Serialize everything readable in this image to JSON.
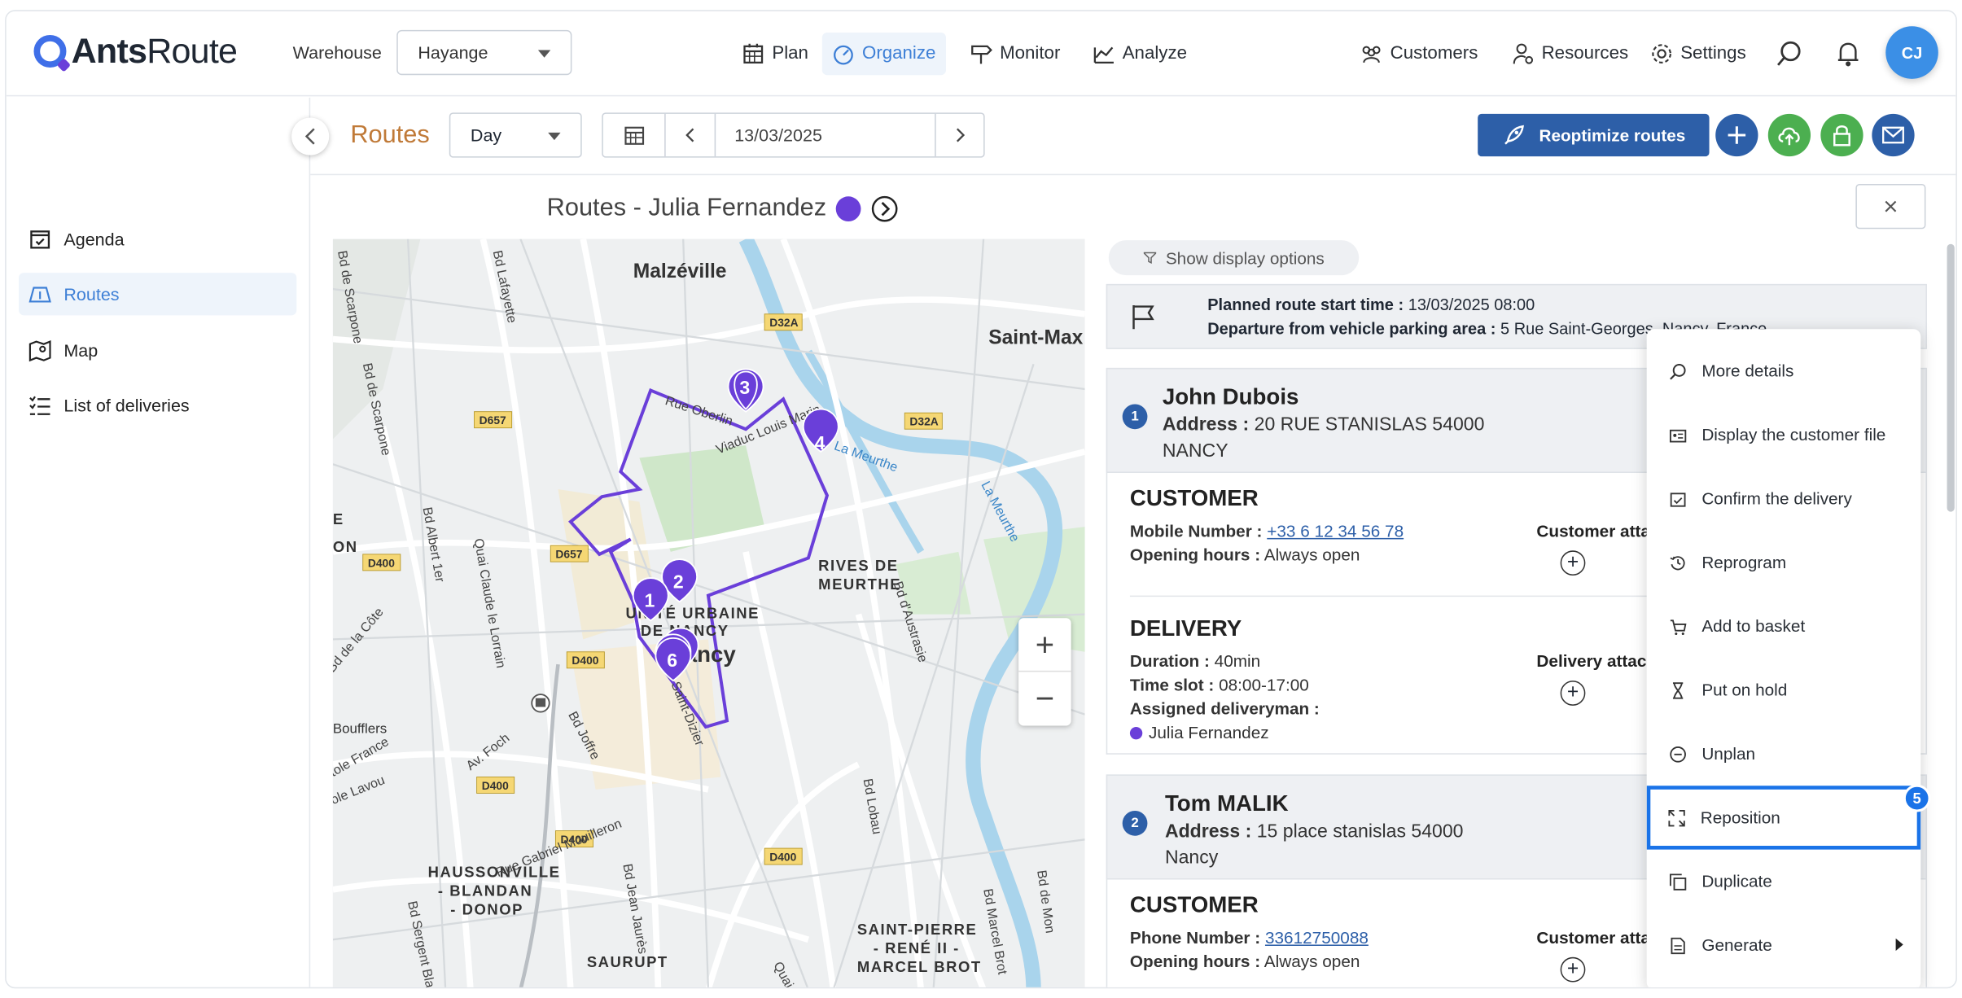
{
  "app": {
    "logo_brand": "Ants",
    "logo_suffix": "Route"
  },
  "header": {
    "warehouse_label": "Warehouse",
    "warehouse_value": "Hayange",
    "nav": [
      {
        "label": "Plan",
        "icon": "calendar-grid-icon"
      },
      {
        "label": "Organize",
        "icon": "speedometer-icon",
        "active": true
      },
      {
        "label": "Monitor",
        "icon": "signpost-icon"
      },
      {
        "label": "Analyze",
        "icon": "chart-icon"
      }
    ],
    "right_nav": [
      {
        "label": "Customers",
        "icon": "people-icon"
      },
      {
        "label": "Resources",
        "icon": "person-gear-icon"
      },
      {
        "label": "Settings",
        "icon": "gear-icon"
      }
    ],
    "avatar_initials": "CJ"
  },
  "sidebar": {
    "items": [
      {
        "label": "Agenda",
        "icon": "calendar-check-icon"
      },
      {
        "label": "Routes",
        "icon": "map-fold-icon",
        "active": true
      },
      {
        "label": "Map",
        "icon": "map-pin-icon"
      },
      {
        "label": "List of deliveries",
        "icon": "list-check-icon"
      }
    ]
  },
  "toolbar": {
    "title": "Routes",
    "period": "Day",
    "date": "13/03/2025",
    "reoptimize_label": "Reoptimize routes"
  },
  "map_panel": {
    "title": "Routes - Julia Fernandez",
    "route_color": "#6a3fd9",
    "labels": {
      "malzeville": "Malzéville",
      "saint_max": "Saint-Max",
      "rives": "RIVES DE",
      "meurthe": "MEURTHE",
      "unite1": "UNITÉ URBAINE",
      "unite2": "DE NANCY",
      "nancy": "Nancy",
      "haussonville1": "HAUSSONVILLE",
      "haussonville2": "- BLANDAN",
      "haussonville3": "- DONOP",
      "saurupt": "SAURUPT",
      "stpierre1": "SAINT-PIERRE",
      "stpierre2": "- RENÉ II -",
      "stpierre3": "MARCEL BROT",
      "rue_oberlin": "Rue Oberlin",
      "viaduc": "Viaduc Louis Marin",
      "la_meurthe": "La Meurthe",
      "bd_lafayette": "Bd Lafayette",
      "bd_scarpone": "Bd de Scarpone",
      "bd_albert": "Bd Albert 1er",
      "quai_claude": "Quai Claude le Lorrain",
      "bd_austrasie": "Bd d'Austrasie",
      "bd_joffre": "Bd Joffre",
      "av_foch": "Av. Foch",
      "bd_lobau": "Bd Lobau",
      "rue_gabriel": "Rue Gabriel Mouilleron",
      "bd_jean_jaures": "Bd Jean Jaurès",
      "rue_st_dizier": "Rue Saint-Dizier",
      "bd_cote": "Bd de la Côte",
      "boufflers": "Boufflers",
      "d32a_1": "D32A",
      "d32a_2": "D32A",
      "d657_1": "D657",
      "d657_2": "D657",
      "d400_1": "D400",
      "d400_2": "D400",
      "d400_3": "D400",
      "d400_4": "D400",
      "d400_5": "D400",
      "ev_fragment": "E\nON",
      "ole_fragment": "tole France",
      "rue_fragment": "ole Lavou",
      "bd_sergent": "Bd Sergent Blandan",
      "bd_marcel": "Bd Marcel Brot",
      "bd_mon": "Bd de Mon",
      "quai_fragment": "Quai"
    },
    "markers": [
      "1",
      "2",
      "3",
      "4",
      "6"
    ],
    "zoom_in": "+",
    "zoom_out": "−"
  },
  "details": {
    "show_options": "Show display options",
    "planned_start_label": "Planned route start time :",
    "planned_start_value": "13/03/2025 08:00",
    "departure_label": "Departure from vehicle parking area :",
    "departure_value": "5 Rue Saint-Georges, Nancy, France",
    "stops": [
      {
        "index": "1",
        "name": "John Dubois",
        "address_label": "Address :",
        "address_line1": "20 RUE STANISLAS 54000",
        "address_line2": "NANCY",
        "customer_heading": "CUSTOMER",
        "phone_label": "Mobile Number :",
        "phone": "+33 6 12 34 56 78",
        "hours_label": "Opening hours :",
        "hours": "Always open",
        "customer_attach": "Customer atta",
        "delivery_heading": "DELIVERY",
        "duration_label": "Duration :",
        "duration": "40min",
        "slot_label": "Time slot :",
        "slot": "08:00-17:00",
        "assigned_label": "Assigned deliveryman :",
        "assigned": "Julia Fernandez",
        "delivery_attach": "Delivery attac"
      },
      {
        "index": "2",
        "name": "Tom MALIK",
        "address_label": "Address :",
        "address_line1": "15 place stanislas 54000",
        "address_line2": "Nancy",
        "customer_heading": "CUSTOMER",
        "phone_label": "Phone Number :",
        "phone": "33612750088",
        "hours_label": "Opening hours :",
        "hours": "Always open",
        "customer_attach": "Customer atta"
      }
    ]
  },
  "context_menu": {
    "items": [
      {
        "label": "More details",
        "icon": "zoom-icon"
      },
      {
        "label": "Display the customer file",
        "icon": "id-card-icon"
      },
      {
        "label": "Confirm the delivery",
        "icon": "calendar-check-icon"
      },
      {
        "label": "Reprogram",
        "icon": "history-icon"
      },
      {
        "label": "Add to basket",
        "icon": "basket-icon"
      },
      {
        "label": "Put on hold",
        "icon": "hourglass-icon"
      },
      {
        "label": "Unplan",
        "icon": "minus-circle-icon"
      },
      {
        "label": "Reposition",
        "icon": "arrows-expand-icon",
        "highlighted": true
      },
      {
        "label": "Duplicate",
        "icon": "copy-icon"
      },
      {
        "label": "Generate",
        "icon": "document-icon",
        "has_submenu": true
      }
    ],
    "step_badge": "5"
  }
}
